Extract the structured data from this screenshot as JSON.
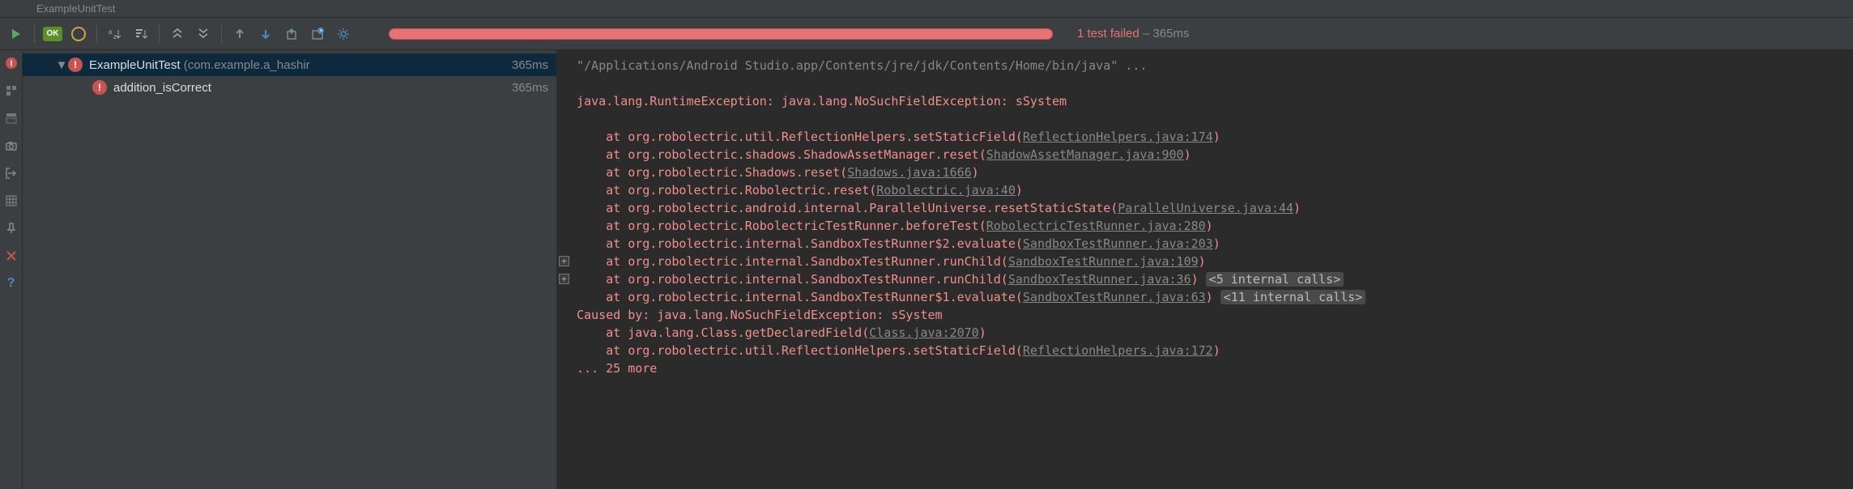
{
  "titleBar": "ExampleUnitTest",
  "status": {
    "failText": "1 test failed",
    "sep": " – ",
    "time": "365ms"
  },
  "tree": {
    "root": {
      "name": "ExampleUnitTest",
      "pkg": " (com.example.a_hashir",
      "time": "365ms"
    },
    "child": {
      "name": "addition_isCorrect",
      "time": "365ms"
    }
  },
  "console": {
    "cmd": "\"/Applications/Android Studio.app/Contents/jre/jdk/Contents/Home/bin/java\" ...",
    "exc": "java.lang.RuntimeException: java.lang.NoSuchFieldException: sSystem",
    "lines": [
      {
        "pre": "    at org.robolectric.util.ReflectionHelpers.setStaticField(",
        "link": "ReflectionHelpers.java:174",
        "post": ")"
      },
      {
        "pre": "    at org.robolectric.shadows.ShadowAssetManager.reset(",
        "link": "ShadowAssetManager.java:900",
        "post": ")"
      },
      {
        "pre": "    at org.robolectric.Shadows.reset(",
        "link": "Shadows.java:1666",
        "post": ")"
      },
      {
        "pre": "    at org.robolectric.Robolectric.reset(",
        "link": "Robolectric.java:40",
        "post": ")"
      },
      {
        "pre": "    at org.robolectric.android.internal.ParallelUniverse.resetStaticState(",
        "link": "ParallelUniverse.java:44",
        "post": ")"
      },
      {
        "pre": "    at org.robolectric.RobolectricTestRunner.beforeTest(",
        "link": "RobolectricTestRunner.java:280",
        "post": ")"
      },
      {
        "pre": "    at org.robolectric.internal.SandboxTestRunner$2.evaluate(",
        "link": "SandboxTestRunner.java:203",
        "post": ")"
      },
      {
        "pre": "    at org.robolectric.internal.SandboxTestRunner.runChild(",
        "link": "SandboxTestRunner.java:109",
        "post": ")"
      },
      {
        "pre": "    at org.robolectric.internal.SandboxTestRunner.runChild(",
        "link": "SandboxTestRunner.java:36",
        "post": ")",
        "badge": "<5 internal calls>"
      },
      {
        "pre": "    at org.robolectric.internal.SandboxTestRunner$1.evaluate(",
        "link": "SandboxTestRunner.java:63",
        "post": ")",
        "badge": "<11 internal calls>"
      }
    ],
    "caused": "Caused by: java.lang.NoSuchFieldException: sSystem",
    "causedLines": [
      {
        "pre": "    at java.lang.Class.getDeclaredField(",
        "link": "Class.java:2070",
        "post": ")"
      },
      {
        "pre": "    at org.robolectric.util.ReflectionHelpers.setStaticField(",
        "link": "ReflectionHelpers.java:172",
        "post": ")"
      }
    ],
    "more": "    ... 25 more"
  }
}
